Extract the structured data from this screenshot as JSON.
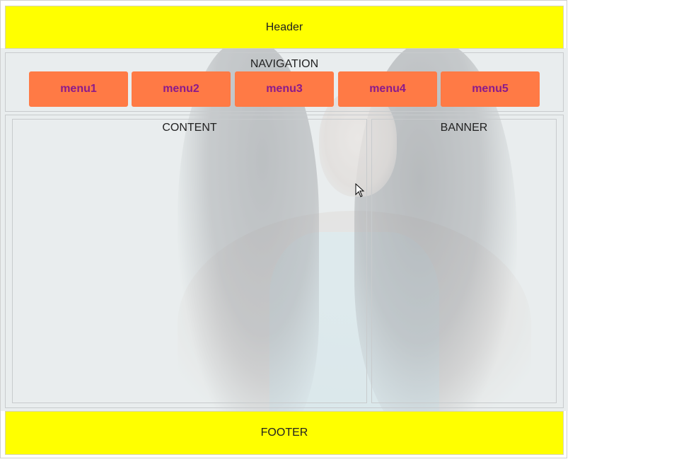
{
  "header": {
    "label": "Header"
  },
  "navigation": {
    "title": "NAVIGATION",
    "menus": [
      "menu1",
      "menu2",
      "menu3",
      "menu4",
      "menu5"
    ]
  },
  "content": {
    "title": "CONTENT"
  },
  "banner": {
    "title": "BANNER"
  },
  "footer": {
    "label": "FOOTER"
  },
  "colors": {
    "header_bg": "#ffff00",
    "footer_bg": "#ffff00",
    "menu_bg": "#ff7a45",
    "menu_text": "#8b1a8b"
  },
  "icons": {
    "cursor": "mouse-pointer-icon"
  }
}
